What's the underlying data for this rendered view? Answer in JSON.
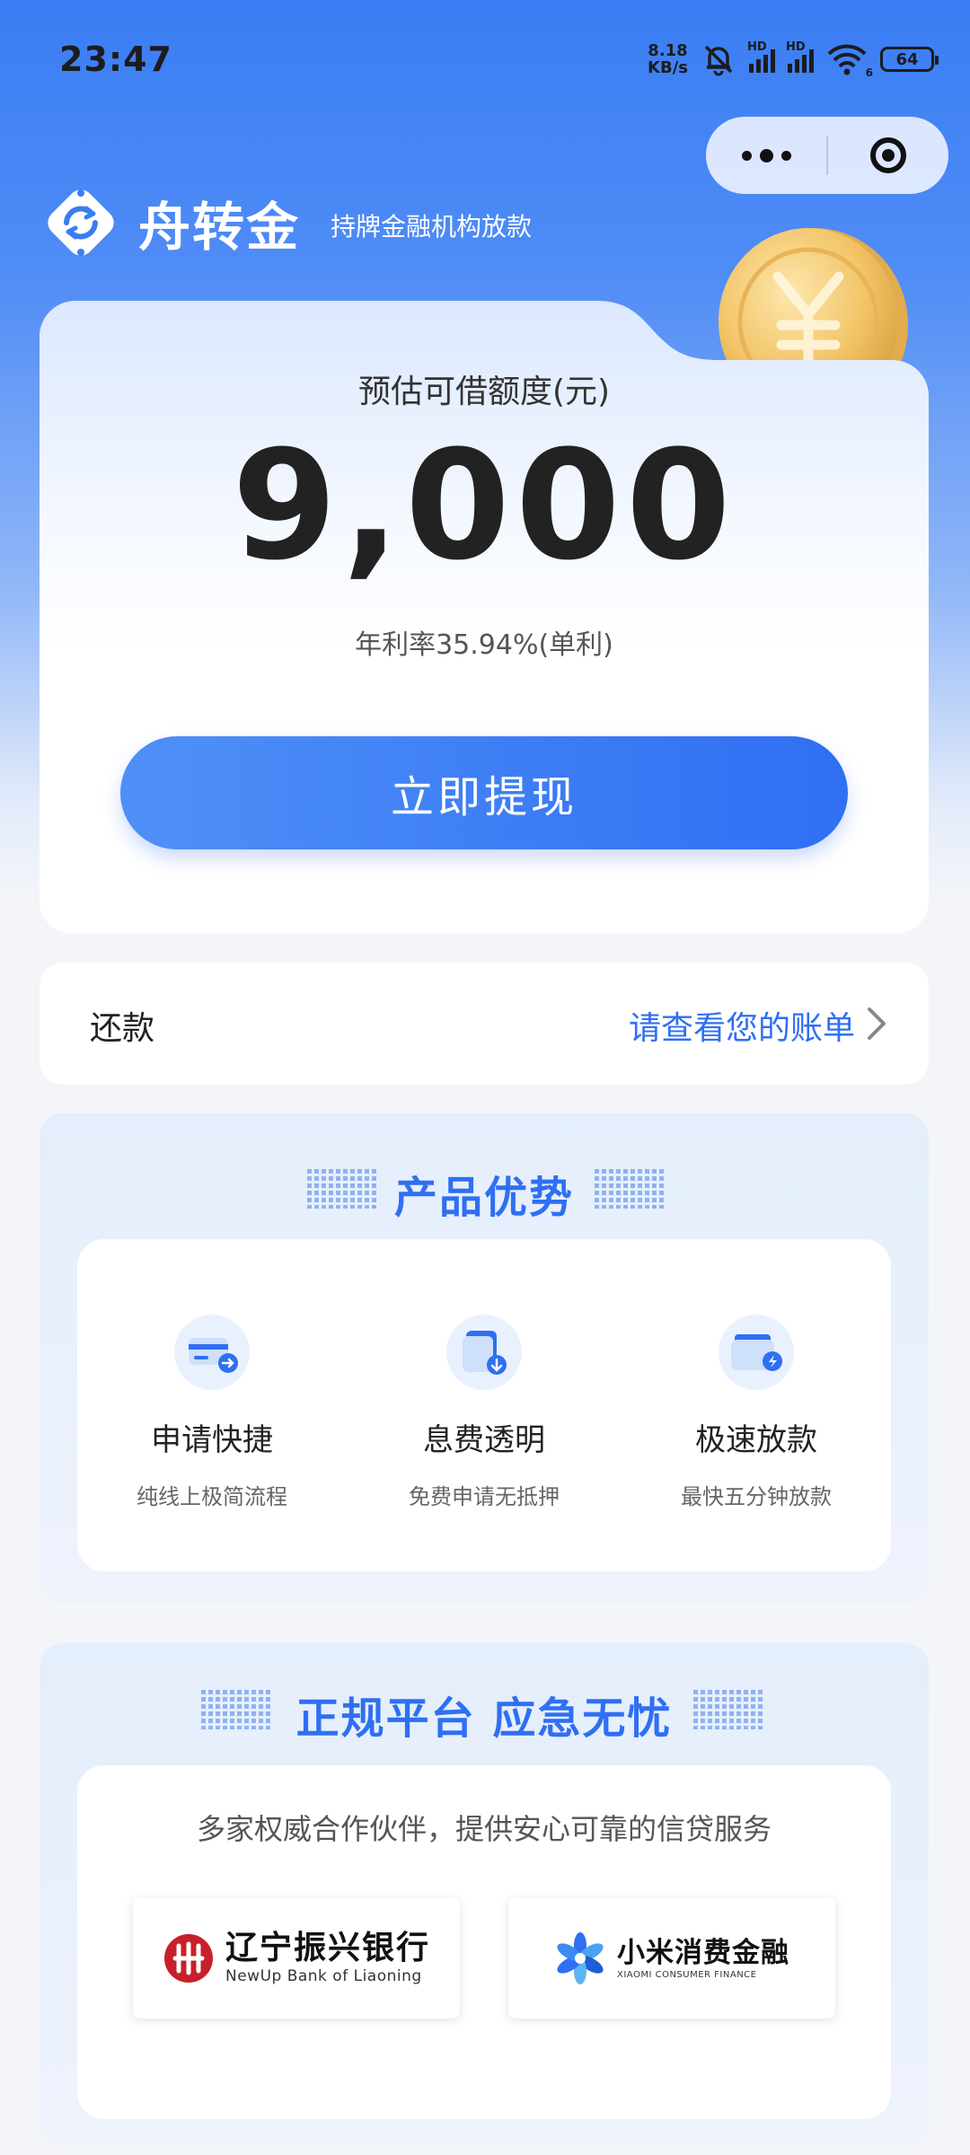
{
  "status_bar": {
    "time": "23:47",
    "net_speed_value": "8.18",
    "net_speed_unit": "KB/s",
    "signal_1_label": "HD",
    "signal_2_label": "HD",
    "wifi_label": "6",
    "battery_level": "64"
  },
  "brand": {
    "name": "舟转金",
    "tagline": "持牌金融机构放款"
  },
  "quota": {
    "label": "预估可借额度(元)",
    "amount": "9,000",
    "rate_text": "年利率35.94%(单利)",
    "withdraw_label": "立即提现"
  },
  "repay": {
    "label": "还款",
    "link_text": "请查看您的账单"
  },
  "product_advantages": {
    "title": "产品优势",
    "features": [
      {
        "title": "申请快捷",
        "desc": "纯线上极简流程",
        "icon": "card-arrow-icon"
      },
      {
        "title": "息费透明",
        "desc": "免费申请无抵押",
        "icon": "document-download-icon"
      },
      {
        "title": "极速放款",
        "desc": "最快五分钟放款",
        "icon": "wallet-lightning-icon"
      }
    ]
  },
  "platform": {
    "title": "正规平台 应急无忧",
    "description": "多家权威合作伙伴，提供安心可靠的信贷服务",
    "partners": [
      {
        "name": "辽宁振兴银行",
        "sub": "NewUp Bank of Liaoning"
      },
      {
        "name": "小米消费金融",
        "sub": "XIAOMI CONSUMER FINANCE"
      }
    ]
  },
  "colors": {
    "brand_blue": "#2f6ff3",
    "header_blue": "#3a7df3",
    "bank_red": "#c8202a"
  }
}
